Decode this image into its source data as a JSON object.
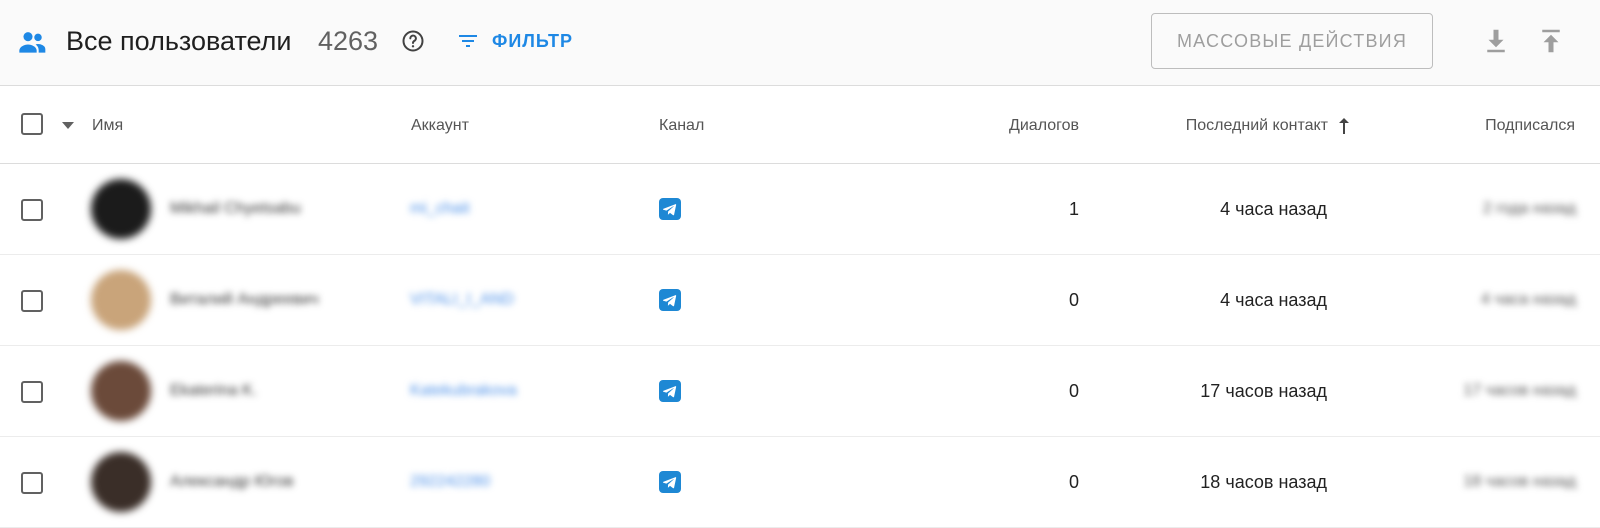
{
  "header": {
    "title": "Все пользователи",
    "count": "4263",
    "filter_label": "ФИЛЬТР",
    "mass_actions_label": "МАССОВЫЕ ДЕЙСТВИЯ"
  },
  "columns": {
    "name": "Имя",
    "account": "Аккаунт",
    "channel": "Канал",
    "dialogs": "Диалогов",
    "last_contact": "Последний контакт",
    "subscribed": "Подписался"
  },
  "sort": {
    "column": "last_contact",
    "direction": "ascending"
  },
  "rows": [
    {
      "name": "Mikhail Chyetsabu",
      "account": "mi_chait",
      "channel": "telegram",
      "dialogs": "1",
      "last_contact": "4 часа назад",
      "subscribed": "2 года назад",
      "avatar_color": "#1b1b1b"
    },
    {
      "name": "Виталий Андреевич",
      "account": "VITALI_I_AND",
      "channel": "telegram",
      "dialogs": "0",
      "last_contact": "4 часа назад",
      "subscribed": "4 часа назад",
      "avatar_color": "#c9a47a"
    },
    {
      "name": "Ekaterina K.",
      "account": "Katekubrakova",
      "channel": "telegram",
      "dialogs": "0",
      "last_contact": "17 часов назад",
      "subscribed": "17 часов назад",
      "avatar_color": "#6b4a3a"
    },
    {
      "name": "Александр Югов",
      "account": "292242280",
      "channel": "telegram",
      "dialogs": "0",
      "last_contact": "18 часов назад",
      "subscribed": "18 часов назад",
      "avatar_color": "#3a2e28"
    }
  ],
  "colors": {
    "accent": "#1e88e5",
    "telegram": "#1e88d4",
    "border": "#dcdcdc"
  }
}
